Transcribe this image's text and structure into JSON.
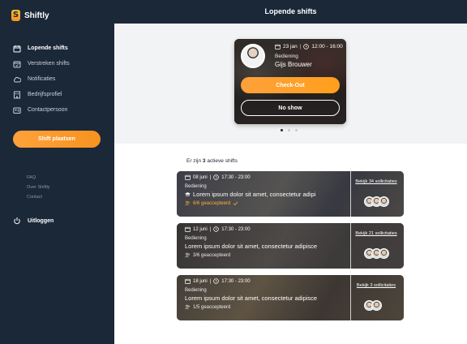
{
  "app": {
    "name": "Shiftly",
    "logo_letter": "S"
  },
  "sidebar": {
    "items": [
      {
        "label": "Lopende shifts",
        "icon": "calendar-icon",
        "active": true
      },
      {
        "label": "Verstreken shifts",
        "icon": "calendar-check-icon",
        "active": false
      },
      {
        "label": "Notificaties",
        "icon": "cloud-icon",
        "active": false
      },
      {
        "label": "Bedrijfsprofiel",
        "icon": "building-icon",
        "active": false
      },
      {
        "label": "Contactpersoon",
        "icon": "contact-card-icon",
        "active": false
      }
    ],
    "cta_label": "Shift plaatsen",
    "links": [
      "FAQ",
      "Over Shiftly",
      "Contact"
    ],
    "logout_label": "Uitloggen"
  },
  "header": {
    "title": "Lopende shifts"
  },
  "featured": {
    "date": "23 jan",
    "time": "12:00 - 16:00",
    "role": "Bediening",
    "name": "Gijs Brouwer",
    "checkout_label": "Check-Out",
    "noshow_label": "No show"
  },
  "carousel": {
    "count": 3,
    "active_index": 0
  },
  "active": {
    "count_prefix": "Er zijn",
    "count": "3",
    "count_suffix": "actieve shifts",
    "shifts": [
      {
        "date": "08 juni",
        "time": "17:30 - 23:00",
        "role": "Bediening",
        "title": "Lorem ipsum dolor sit amet, consectetur adipi",
        "accepted": "6/6 geaccepteerd",
        "applications_label": "Bekijk 34 sollicitaties",
        "avatars": 3,
        "full": true
      },
      {
        "date": "12 juni",
        "time": "17:30 - 23:00",
        "role": "Bediening",
        "title": "Lorem ipsum dolor sit amet, consectetur adipisce",
        "accepted": "3/6 geaccepteerd",
        "applications_label": "Bekijk 21 sollicitaties",
        "avatars": 3,
        "full": false
      },
      {
        "date": "18 juni",
        "time": "17:30 - 23:00",
        "role": "Bediening",
        "title": "Lorem ipsum dolor sit amet, consectetur adipisce",
        "accepted": "1/5 geaccepteerd",
        "applications_label": "Bekijk 3 sollicitaties",
        "avatars": 2,
        "full": false
      }
    ]
  },
  "colors": {
    "sidebar_bg": "#1b2838",
    "accent": "#f7931e",
    "warning": "#ffb02e"
  }
}
